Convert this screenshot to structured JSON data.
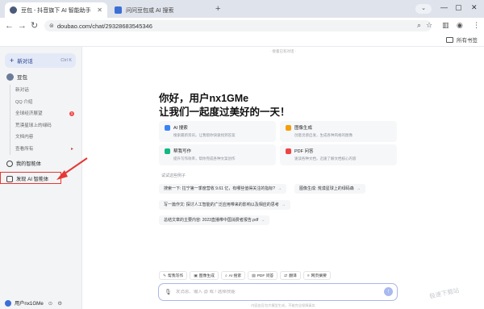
{
  "browser": {
    "tabs": [
      {
        "label": "豆包 - 抖音旗下 AI 智能助手",
        "favicon_color": "#4a5a7a"
      },
      {
        "label": "问问豆包或 AI 搜索",
        "favicon_color": "#3b6fd6"
      }
    ],
    "address": "doubao.com/chat/29328683545346",
    "bookmarks_all": "所有书签",
    "nav_icons": [
      "back-icon",
      "forward-icon",
      "reload-icon"
    ]
  },
  "sidebar": {
    "new_chat": "新对话",
    "new_chat_shortcut": "Ctrl K",
    "bot_name": "豆包",
    "sub_items": [
      {
        "label": "新对话"
      },
      {
        "label": "QQ 介绍"
      },
      {
        "label": "全球经济展望",
        "badge": "1"
      },
      {
        "label": "荒漠星球上的绿码"
      },
      {
        "label": "文档内容"
      },
      {
        "label": "查看所有",
        "caret": "▸"
      }
    ],
    "my_agents": "我的智能体",
    "discover_agents": "发现 AI 智能体",
    "user_name": "用户nx1GMe"
  },
  "main": {
    "save_hint": "· 接着已有对话 ·",
    "greeting_line1": "你好，用户nx1GMe",
    "greeting_line2": "让我们一起度过美好的一天！",
    "cards": [
      {
        "title": "AI 搜索",
        "desc": "搜索最新资讯，让我帮你快速找到答案",
        "color": "#3b82f6"
      },
      {
        "title": "图像生成",
        "desc": "创意灵感启发，生成各种风格的图像",
        "color": "#f59e0b"
      },
      {
        "title": "帮我写作",
        "desc": "提升写作效率，帮你完成各种文案创作",
        "color": "#10b981"
      },
      {
        "title": "PDF 问答",
        "desc": "速读各种文档，迅速了解文档核心内容",
        "color": "#ef4444"
      }
    ],
    "try_label": "试试这些例子",
    "chips": [
      "搜索一下: 拉宁第一季度营收 9.61 亿，有哪些值得关注的指标?",
      "图像生成: 荒漠星球上的绿码森",
      "写一篇作文: 探讨人工智能的广泛应用带来的影响以及相应的思考",
      "总结文章的主要内容: 2023直播带中国消费者报告.pdf"
    ],
    "actions": [
      {
        "icon": "✎",
        "label": "帮我写作"
      },
      {
        "icon": "▣",
        "label": "图像生成"
      },
      {
        "icon": "⌕",
        "label": "AI 搜索"
      },
      {
        "icon": "▤",
        "label": "PDF 问答"
      },
      {
        "icon": "⇄",
        "label": "翻译"
      },
      {
        "icon": "≡",
        "label": "网页摘要"
      }
    ],
    "input_placeholder": "发消息、输入 @ 或 / 选择技能",
    "footnote": "内容由豆包大模型生成，不能完全保障真实",
    "watermark": "极速下载站"
  }
}
